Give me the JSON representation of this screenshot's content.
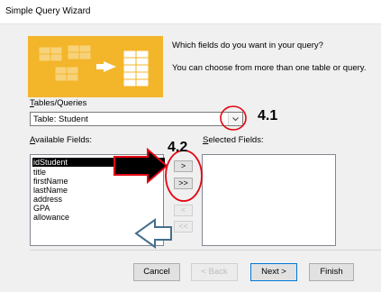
{
  "window": {
    "title": "Simple Query Wizard"
  },
  "intro": {
    "line1": "Which fields do you want in your query?",
    "line2": "You can choose from more than one table or query."
  },
  "tables": {
    "label": "Tables/Queries",
    "label_underline": "T",
    "label_rest": "ables/Queries",
    "value": "Table: Student"
  },
  "available": {
    "label_underline": "A",
    "label_rest": "vailable Fields:",
    "items": [
      "idStudent",
      "title",
      "firstName",
      "lastName",
      "address",
      "GPA",
      "allowance"
    ],
    "selected_index": 0
  },
  "selected": {
    "label_underline": "S",
    "label_rest": "elected Fields:"
  },
  "movers": {
    "add_one": ">",
    "add_all": ">>",
    "remove_one": "<",
    "remove_all": "<<"
  },
  "buttons": {
    "cancel": "Cancel",
    "back": "< Back",
    "next": "Next >",
    "finish": "Finish"
  },
  "annotations": {
    "step1": "4.1",
    "step2": "4.2"
  },
  "colors": {
    "banner": "#f3b52a",
    "annotation_red": "#e30613",
    "arrow_blue": "#44708c"
  }
}
